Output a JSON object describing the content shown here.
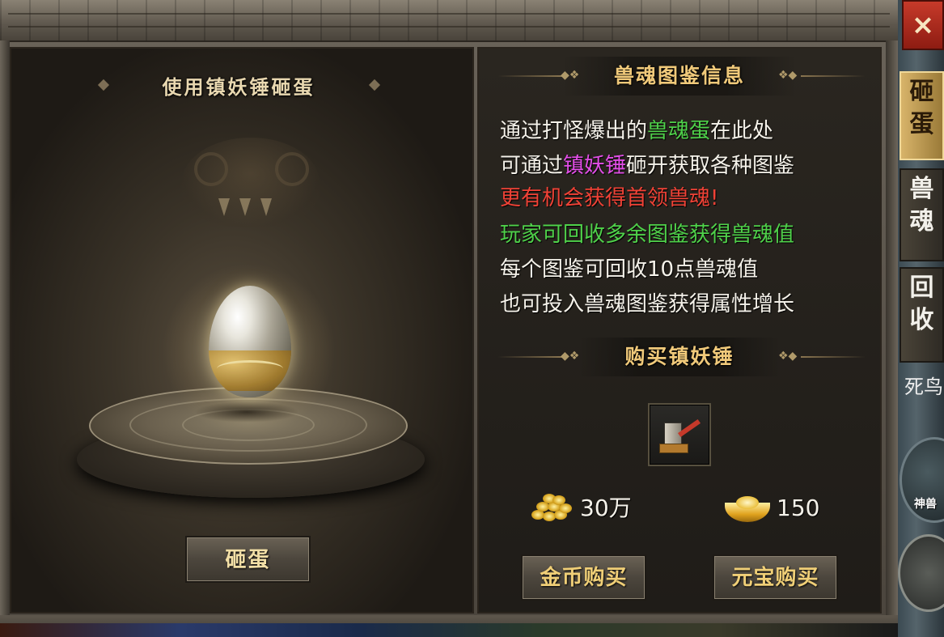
{
  "close_label": "×",
  "left_panel": {
    "title": "使用镇妖锤砸蛋",
    "smash_button": "砸蛋"
  },
  "info_section": {
    "title": "兽魂图鉴信息",
    "line1": {
      "a": "通过打怪爆出的",
      "b": "兽魂蛋",
      "c": "在此处"
    },
    "line2": {
      "a": "可通过",
      "b": "镇妖锤",
      "c": "砸开获取各种图鉴"
    },
    "line3": "更有机会获得首领兽魂!",
    "line4": "玩家可回收多余图鉴获得兽魂值",
    "line5": "每个图鉴可回收10点兽魂值",
    "line6": "也可投入兽魂图鉴获得属性增长"
  },
  "buy_section": {
    "title": "购买镇妖锤",
    "item_icon": "hammer-icon",
    "gold_price": "30万",
    "ingot_price": "150",
    "gold_buy_button": "金币购买",
    "ingot_buy_button": "元宝购买"
  },
  "side_tabs": {
    "tab1": "砸蛋",
    "tab2": "兽魂",
    "tab3": "回收",
    "partial_text": "死鸟",
    "shenshou_label": "神兽"
  },
  "colors": {
    "green": "#4fd14a",
    "magenta": "#e34ee8",
    "red": "#f04236",
    "gold": "#f0c97a"
  }
}
